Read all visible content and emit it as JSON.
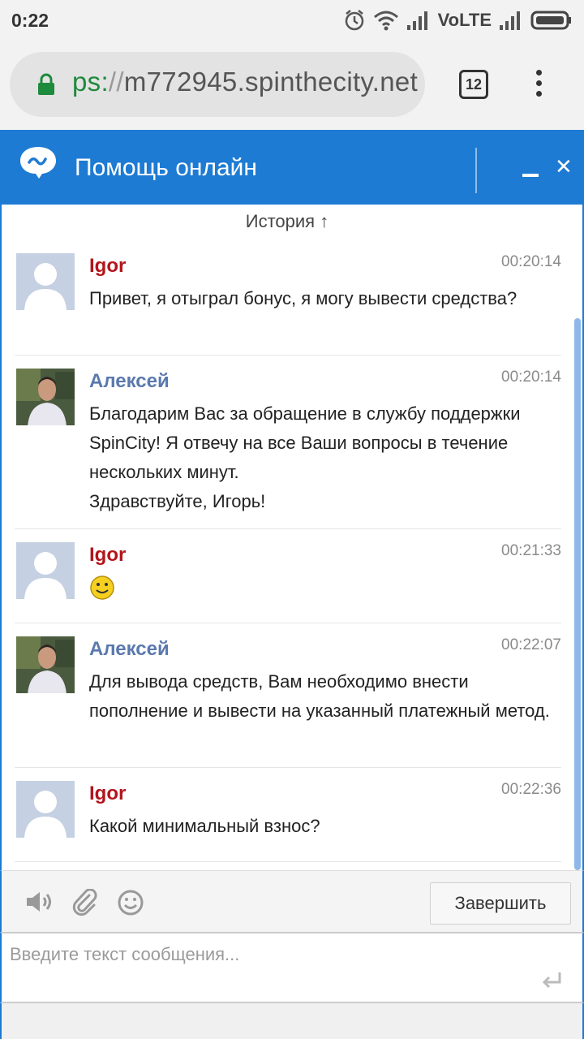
{
  "status_bar": {
    "time": "0:22",
    "network_label": "VoLTE",
    "icons": [
      "alarm-icon",
      "wifi-icon",
      "signal-icon",
      "signal-icon-2",
      "battery-icon"
    ]
  },
  "browser": {
    "url_scheme": "ps:",
    "url_sep": "//",
    "url_host": "m772945.spinthecity.net",
    "tab_count": "12",
    "icons": [
      "lock-icon",
      "tabs-icon",
      "overflow-menu-icon"
    ]
  },
  "chat": {
    "title": "Помощь онлайн",
    "history_label": "История ↑",
    "accent_color": "#1e7bd3",
    "messages": [
      {
        "author": "Igor",
        "time": "00:20:14",
        "text": "Привет, я отыграл бонус, я могу вывести средства?"
      },
      {
        "author": "Алексей",
        "time": "00:20:14",
        "text_lines": [
          "Благодарим Вас за обращение в службу поддержки SpinCity! Я отвечу на все Ваши вопросы в течение нескольких минут.",
          "Здравствуйте, Игорь!"
        ]
      },
      {
        "author": "Igor",
        "time": "00:21:33",
        "emoji": "smiley-icon"
      },
      {
        "author": "Алексей",
        "time": "00:22:07",
        "text": "Для вывода средств, Вам необходимо внести пополнение и вывести на указанный платежный метод."
      },
      {
        "author": "Igor",
        "time": "00:22:36",
        "text": "Какой минимальный взнос?"
      }
    ],
    "toolbar": {
      "finish_label": "Завершить",
      "icons": [
        "speaker-icon",
        "paperclip-icon",
        "emoji-icon"
      ]
    },
    "input": {
      "placeholder": "Введите текст сообщения...",
      "value": ""
    }
  }
}
